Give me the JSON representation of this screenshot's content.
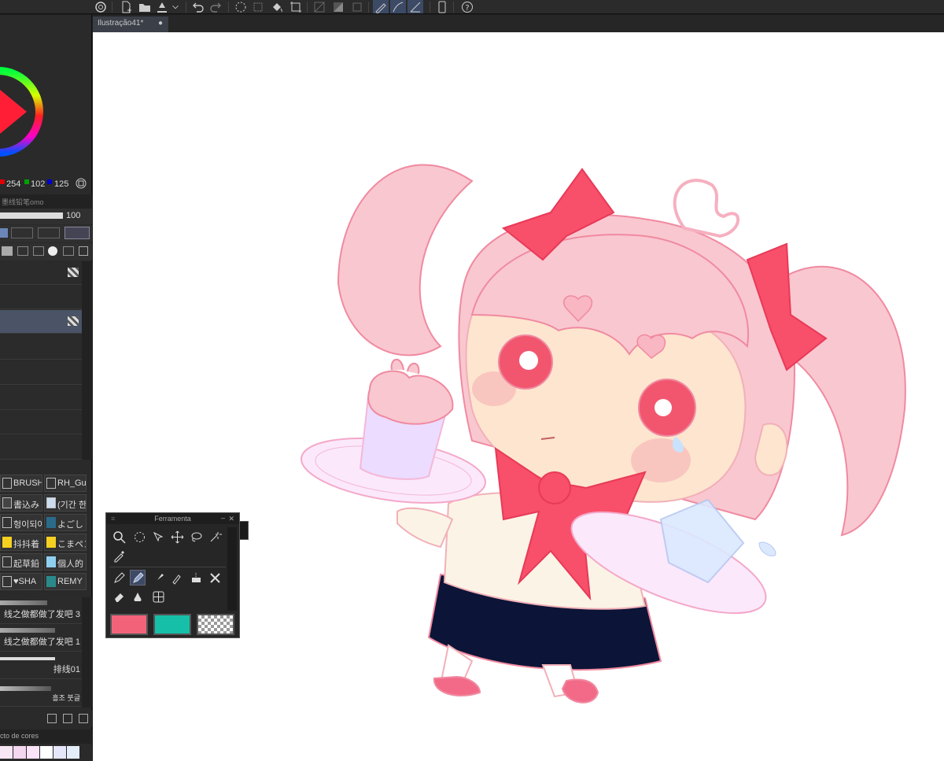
{
  "document": {
    "tab_title": "Ilustração41*",
    "modified_marker": "●"
  },
  "color": {
    "r": "254",
    "g": "102",
    "b": "125",
    "swatch_r": "#e00000",
    "swatch_g": "#00a000",
    "swatch_b": "#0000d0",
    "wheel_marker": "#ff3352"
  },
  "layer_panel": {
    "tab_label": "墨线铅笔omo",
    "opacity": "100"
  },
  "brushes": [
    {
      "left": "BRUSH",
      "right": "RH_Gu"
    },
    {
      "left": "書込み",
      "right": "(기간 한"
    },
    {
      "left": "헝이되어",
      "right": "よごし"
    },
    {
      "left": "抖抖着",
      "right": "こまペン"
    },
    {
      "left": "起草鉛",
      "right": "個人的"
    },
    {
      "left": "♥SHA",
      "right": "REMY"
    }
  ],
  "stroke_list": [
    "线之做都做了发吧 3",
    "线之做都做了发吧 1",
    "排线01",
    "흘조 붓글"
  ],
  "bottom_panel": {
    "tab_label": "cto de cores"
  },
  "tool_palette": {
    "title": "Ferramenta",
    "main_color": "#f2637a",
    "sub_color": "#16c0a8",
    "transparent_label": "transparent-swatch"
  },
  "colors": {
    "accent": "#3c4a66"
  }
}
